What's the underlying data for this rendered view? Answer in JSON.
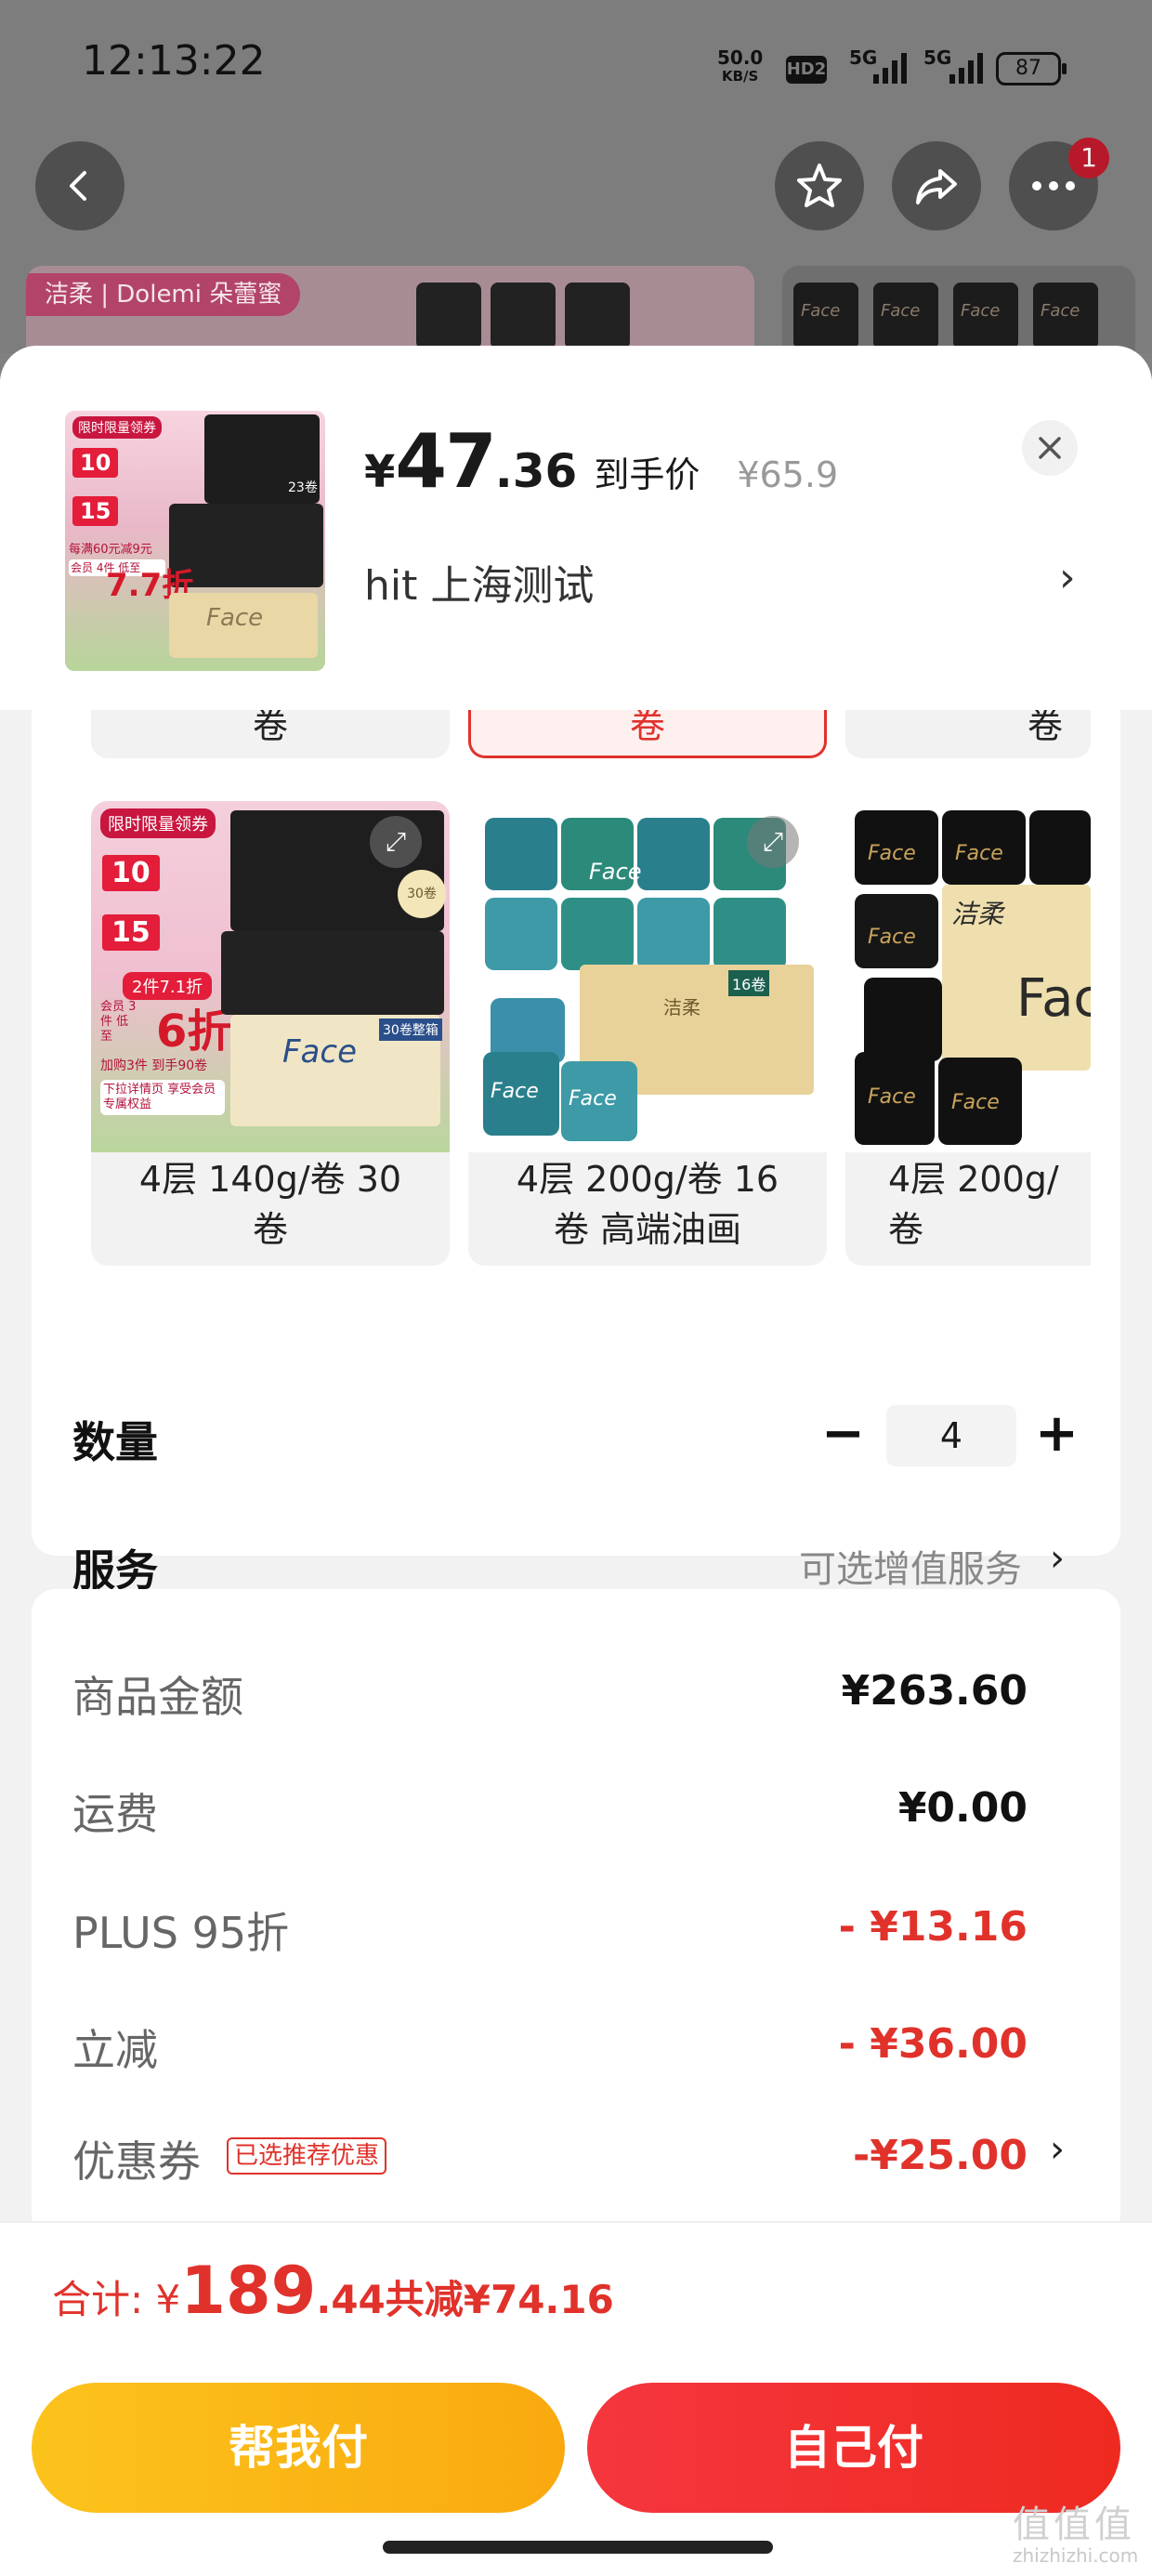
{
  "status_bar": {
    "time": "12:13:22",
    "net_speed_value": "50.0",
    "net_speed_unit": "KB/S",
    "hd_label": "HD2",
    "signal1_label": "5G",
    "signal2_label": "5G",
    "battery_level": "87"
  },
  "top_nav": {
    "notification_count": "1"
  },
  "banner": {
    "brand_tag": "洁柔 | Dolemi 朵蕾蜜",
    "roll_text": "Face"
  },
  "sheet": {
    "price_symbol": "¥",
    "price_int": "47",
    "price_dec": ".36",
    "price_caption": "到手价",
    "original_price": "¥65.9",
    "address": "hit  上海测试",
    "address_arrow": "›",
    "thumb": {
      "promo1": "限时限量领券",
      "promo2_amount": "10",
      "promo3_amount": "15",
      "promo4": "每满60元减9元",
      "promo5_discount": "7.7折",
      "promo5_side": "会员 4件 低至",
      "brand": "Face",
      "count": "23卷"
    },
    "spec_top_row": [
      {
        "label": "卷",
        "selected": false
      },
      {
        "label": "卷",
        "selected": true
      },
      {
        "label": "卷",
        "selected": false
      }
    ],
    "spec_options": [
      {
        "label": "4层 140g/卷 30\n卷",
        "promo_title": "限时限量领券",
        "promo_10": "10",
        "promo_15": "15",
        "promo_deal": "2件7.1折",
        "promo_big": "6折",
        "promo_side": "会员 3件 低至",
        "promo_extra": "加购3件 到手90卷",
        "promo_member": "下拉详情页 享受会员专属权益",
        "brand": "Face",
        "count": "30卷",
        "count_box": "30卷整箱"
      },
      {
        "label": "4层 200g/卷 16\n卷 高端油画",
        "brand": "Face",
        "count": "16卷",
        "brand_small": "洁柔"
      },
      {
        "label": "4层 200g/\n卷",
        "brand": "Face",
        "brand_small": "洁柔"
      }
    ],
    "quantity_label": "数量",
    "quantity_value": "4",
    "minus_symbol": "−",
    "plus_symbol": "+",
    "service_label": "服务",
    "service_value": "可选增值服务",
    "chevron": "›"
  },
  "summary": {
    "rows": [
      {
        "label": "商品金额",
        "value": "¥263.60",
        "red": false
      },
      {
        "label": "运费",
        "value": "¥0.00",
        "red": false
      },
      {
        "label": "PLUS 95折",
        "value": "- ¥13.16",
        "red": true
      },
      {
        "label": "立减",
        "value": "- ¥36.00",
        "red": true
      },
      {
        "label": "优惠券",
        "value": "-¥25.00",
        "red": true
      }
    ],
    "coupon_badge": "已选推荐优惠"
  },
  "total": {
    "prefix": "合计: ¥",
    "int": "189",
    "dec": ".44",
    "saved": " 共减¥74.16"
  },
  "buttons": {
    "friend_pay": "帮我付",
    "self_pay": "自己付"
  },
  "watermark": {
    "main": "值值值",
    "sub": "zhizhizhi.com"
  },
  "colors": {
    "accent_red": "#e0322b",
    "button_yellow": "#fcc31c",
    "button_red": "#f5363e",
    "overlay_gray": "#7d7d7d"
  }
}
